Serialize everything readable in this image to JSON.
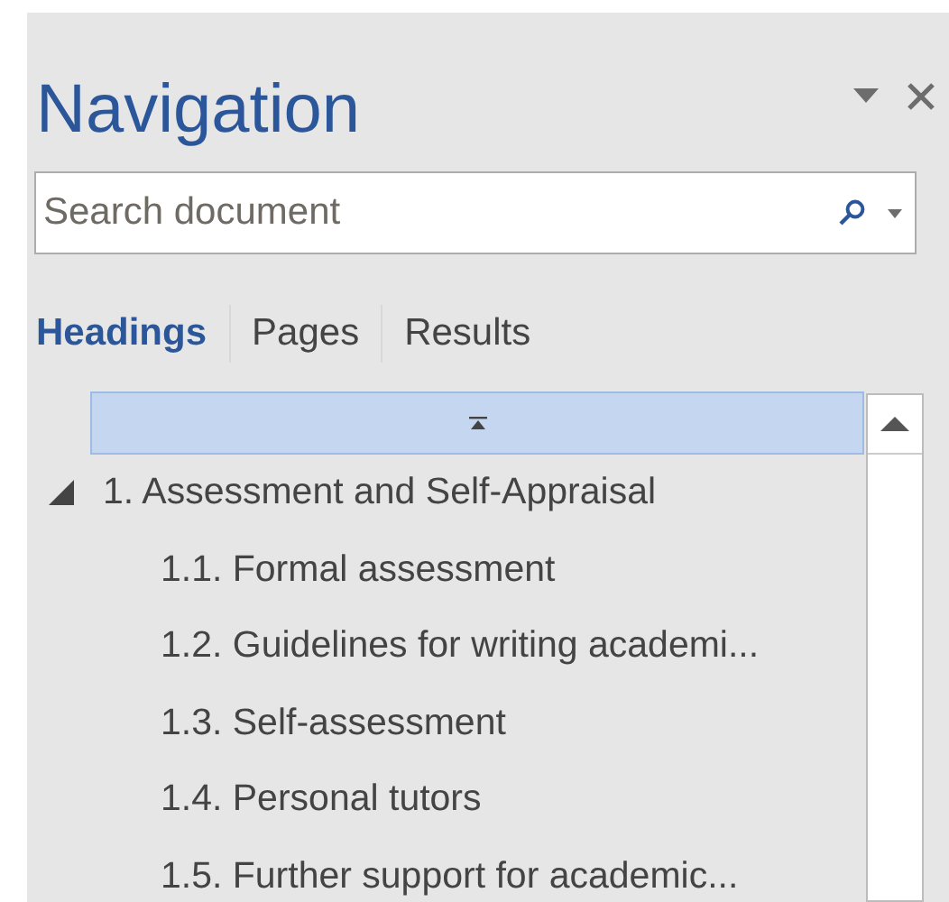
{
  "panel": {
    "title": "Navigation"
  },
  "search": {
    "placeholder": "Search document"
  },
  "tabs": [
    {
      "label": "Headings",
      "selected": true
    },
    {
      "label": "Pages",
      "selected": false
    },
    {
      "label": "Results",
      "selected": false
    }
  ],
  "headings": [
    {
      "label": "1. Assessment and Self-Appraisal",
      "expanded": true,
      "children": [
        {
          "label": "1.1. Formal assessment"
        },
        {
          "label": "1.2. Guidelines for writing academi..."
        },
        {
          "label": "1.3. Self-assessment"
        },
        {
          "label": "1.4. Personal tutors"
        },
        {
          "label": "1.5. Further support for academic..."
        }
      ]
    }
  ]
}
